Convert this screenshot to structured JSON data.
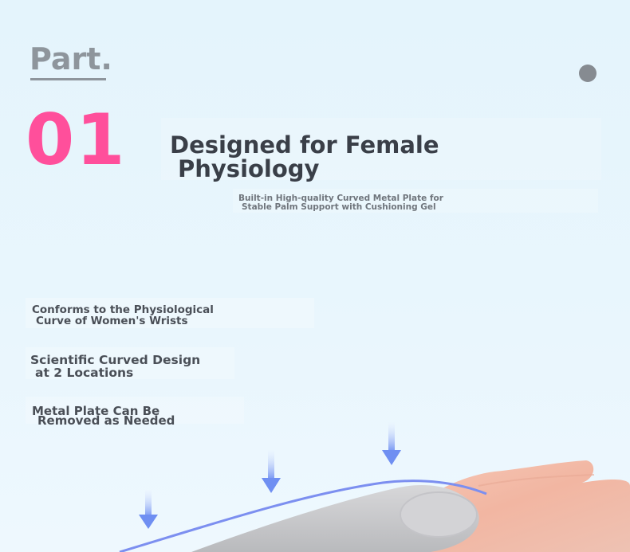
{
  "section": {
    "part_label": "Part.",
    "number": "01",
    "title_line1": "Designed for Female",
    "title_line2": "Physiology",
    "subtitle_line1": "Built-in High-quality Curved Metal Plate for",
    "subtitle_line2": "Stable Palm Support with Cushioning Gel"
  },
  "features": [
    {
      "line1": "Conforms to the Physiological",
      "line2": "Curve of Women's Wrists"
    },
    {
      "line1": "Scientific Curved Design",
      "line2": "at 2 Locations"
    },
    {
      "line1": "Metal Plate Can Be",
      "line2": "Removed as Needed"
    }
  ],
  "colors": {
    "accent_pink": "#ff4f9b",
    "title_dark": "#3a3f48",
    "muted_gray": "#8e959c",
    "arrow_blue": "#6f8ff2"
  },
  "icons": [
    "down-arrow-icon",
    "dot-icon"
  ]
}
